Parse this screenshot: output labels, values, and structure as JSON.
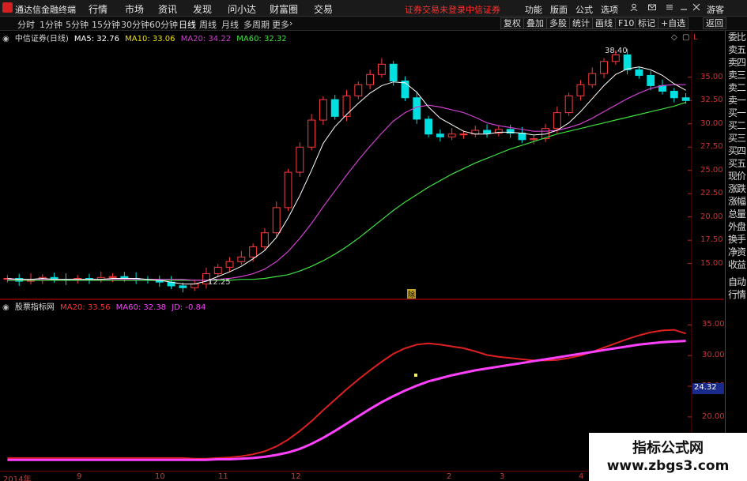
{
  "app": {
    "title": "通达信金融终端",
    "menu": [
      "行情",
      "市场",
      "资讯",
      "发现",
      "问小达",
      "财富圈",
      "交易"
    ],
    "login_status": "证券交易未登录",
    "broker": "中信证券",
    "right_menu": [
      "功能",
      "版面",
      "公式",
      "选项"
    ],
    "guest": "游客"
  },
  "toolbar": {
    "periods": [
      "分时",
      "1分钟",
      "5分钟",
      "15分钟",
      "30分钟",
      "60分钟",
      "日线",
      "周线",
      "月线",
      "多周期",
      "更多"
    ],
    "active_period": "日线",
    "buttons": [
      "复权",
      "叠加",
      "多股",
      "统计",
      "画线",
      "F10",
      "标记",
      "+自选",
      "返回"
    ]
  },
  "main_chart": {
    "stock_name": "中信证券(日线)",
    "ma5_label": "MA5: 32.76",
    "ma10_label": "MA10: 33.06",
    "ma20_label": "MA20: 34.22",
    "ma60_label": "MA60: 32.32",
    "high_annotation": "38.40",
    "low_annotation": "12.25",
    "marker": "除"
  },
  "sub_chart": {
    "indicator_name": "股票指标网",
    "ma20_label": "MA20: 33.56",
    "ma60_label": "MA60: 32.38",
    "jd_label": "JD: -0.84",
    "current_value": "24.32"
  },
  "side_tabs": [
    "委比",
    "卖五",
    "卖四",
    "卖三",
    "卖二",
    "卖一",
    "买一",
    "买二",
    "买三",
    "买四",
    "买五",
    "现价",
    "涨跌",
    "涨幅",
    "总量",
    "外盘",
    "换手",
    "净资",
    "收益",
    "自动",
    "行情"
  ],
  "x_axis": [
    "2014年",
    "9",
    "10",
    "11",
    "12",
    "2",
    "3",
    "4"
  ],
  "colors": {
    "up": "#ff3b3b",
    "down": "#00e0e0",
    "ma5": "#ffffff",
    "ma10": "#f0e000",
    "ma20": "#d040d0",
    "ma60": "#40e040",
    "sub_ma20": "#e02020",
    "sub_ma60": "#ff40ff"
  },
  "watermark": {
    "title": "指标公式网",
    "url": "www.zbgs3.com"
  },
  "chart_data": [
    {
      "type": "candlestick",
      "title": "中信证券(日线)",
      "y_ticks": [
        15.0,
        17.5,
        20.0,
        22.5,
        25.0,
        27.5,
        30.0,
        32.5,
        35.0
      ],
      "ylim": [
        12.0,
        38.8
      ],
      "x_labels": [
        "2014年",
        "9",
        "10",
        "11",
        "12",
        "2",
        "3",
        "4"
      ],
      "close": [
        13.4,
        13.1,
        13.3,
        13.5,
        13.3,
        13.2,
        13.4,
        13.3,
        13.5,
        13.6,
        13.4,
        13.3,
        13.2,
        13.0,
        12.6,
        12.4,
        12.8,
        13.9,
        14.6,
        15.2,
        15.7,
        16.8,
        18.3,
        21.0,
        24.8,
        27.5,
        30.4,
        32.6,
        30.8,
        33.0,
        34.2,
        35.3,
        36.4,
        34.6,
        32.8,
        30.5,
        28.9,
        28.6,
        28.9,
        28.9,
        29.3,
        29.0,
        29.4,
        29.0,
        28.3,
        28.4,
        29.5,
        31.2,
        33.0,
        34.2,
        35.4,
        36.7,
        37.4,
        35.8,
        35.2,
        34.1,
        33.5,
        32.8,
        32.5
      ],
      "ma5": [
        13.4,
        13.3,
        13.3,
        13.4,
        13.3,
        13.3,
        13.3,
        13.3,
        13.3,
        13.4,
        13.4,
        13.4,
        13.3,
        13.2,
        13.0,
        12.8,
        12.8,
        13.1,
        13.6,
        14.1,
        14.7,
        15.5,
        16.4,
        17.8,
        19.9,
        22.3,
        25.0,
        27.9,
        29.7,
        31.0,
        32.2,
        33.3,
        34.1,
        34.5,
        34.4,
        33.4,
        31.8,
        30.6,
        29.9,
        29.2,
        28.9,
        28.9,
        29.1,
        29.1,
        29.0,
        28.8,
        28.9,
        29.3,
        30.1,
        31.3,
        32.7,
        34.1,
        35.3,
        35.9,
        36.1,
        35.8,
        35.2,
        34.3,
        33.6
      ],
      "ma20": [
        13.3,
        13.3,
        13.3,
        13.3,
        13.3,
        13.3,
        13.3,
        13.3,
        13.3,
        13.3,
        13.3,
        13.3,
        13.3,
        13.3,
        13.3,
        13.3,
        13.2,
        13.2,
        13.3,
        13.4,
        13.6,
        13.9,
        14.4,
        15.2,
        16.3,
        17.7,
        19.3,
        21.1,
        22.8,
        24.5,
        26.1,
        27.6,
        29.0,
        30.3,
        31.2,
        31.8,
        32.0,
        31.8,
        31.5,
        31.2,
        30.7,
        30.1,
        29.8,
        29.6,
        29.4,
        29.2,
        29.2,
        29.3,
        29.6,
        30.0,
        30.6,
        31.3,
        32.0,
        32.7,
        33.3,
        33.8,
        34.1,
        34.2,
        34.2
      ],
      "ma60": [
        13.2,
        13.2,
        13.2,
        13.2,
        13.2,
        13.2,
        13.2,
        13.2,
        13.2,
        13.2,
        13.2,
        13.2,
        13.2,
        13.2,
        13.2,
        13.2,
        13.2,
        13.2,
        13.2,
        13.2,
        13.3,
        13.3,
        13.4,
        13.6,
        13.8,
        14.2,
        14.7,
        15.3,
        16.0,
        16.8,
        17.7,
        18.7,
        19.7,
        20.7,
        21.6,
        22.4,
        23.2,
        23.9,
        24.6,
        25.2,
        25.8,
        26.3,
        26.8,
        27.3,
        27.7,
        28.1,
        28.5,
        28.9,
        29.2,
        29.5,
        29.8,
        30.1,
        30.4,
        30.7,
        31.0,
        31.3,
        31.6,
        31.9,
        32.3
      ]
    },
    {
      "type": "line",
      "title": "股票指标网",
      "y_ticks": [
        20.0,
        25.0,
        30.0,
        35.0
      ],
      "ylim": [
        12.0,
        37.5
      ],
      "series": [
        {
          "name": "MA20",
          "values": [
            13.3,
            13.3,
            13.3,
            13.3,
            13.3,
            13.3,
            13.3,
            13.3,
            13.3,
            13.3,
            13.3,
            13.3,
            13.3,
            13.3,
            13.3,
            13.3,
            13.2,
            13.2,
            13.3,
            13.4,
            13.6,
            13.9,
            14.4,
            15.2,
            16.3,
            17.7,
            19.3,
            21.1,
            22.8,
            24.5,
            26.1,
            27.6,
            29.0,
            30.3,
            31.2,
            31.8,
            32.0,
            31.8,
            31.5,
            31.2,
            30.7,
            30.1,
            29.8,
            29.6,
            29.4,
            29.2,
            29.2,
            29.3,
            29.6,
            30.0,
            30.6,
            31.3,
            32.0,
            32.7,
            33.3,
            33.8,
            34.1,
            34.2,
            33.6
          ]
        },
        {
          "name": "MA60",
          "values": [
            13.0,
            13.0,
            13.0,
            13.0,
            13.0,
            13.0,
            13.0,
            13.0,
            13.0,
            13.0,
            13.0,
            13.0,
            13.0,
            13.0,
            13.0,
            13.0,
            13.0,
            13.0,
            13.1,
            13.1,
            13.2,
            13.3,
            13.5,
            13.8,
            14.2,
            14.8,
            15.6,
            16.6,
            17.7,
            18.9,
            20.1,
            21.3,
            22.4,
            23.4,
            24.3,
            25.1,
            25.8,
            26.3,
            26.8,
            27.2,
            27.6,
            27.9,
            28.2,
            28.5,
            28.8,
            29.1,
            29.4,
            29.7,
            30.0,
            30.3,
            30.6,
            30.9,
            31.2,
            31.5,
            31.8,
            32.0,
            32.2,
            32.3,
            32.4
          ]
        }
      ]
    }
  ]
}
